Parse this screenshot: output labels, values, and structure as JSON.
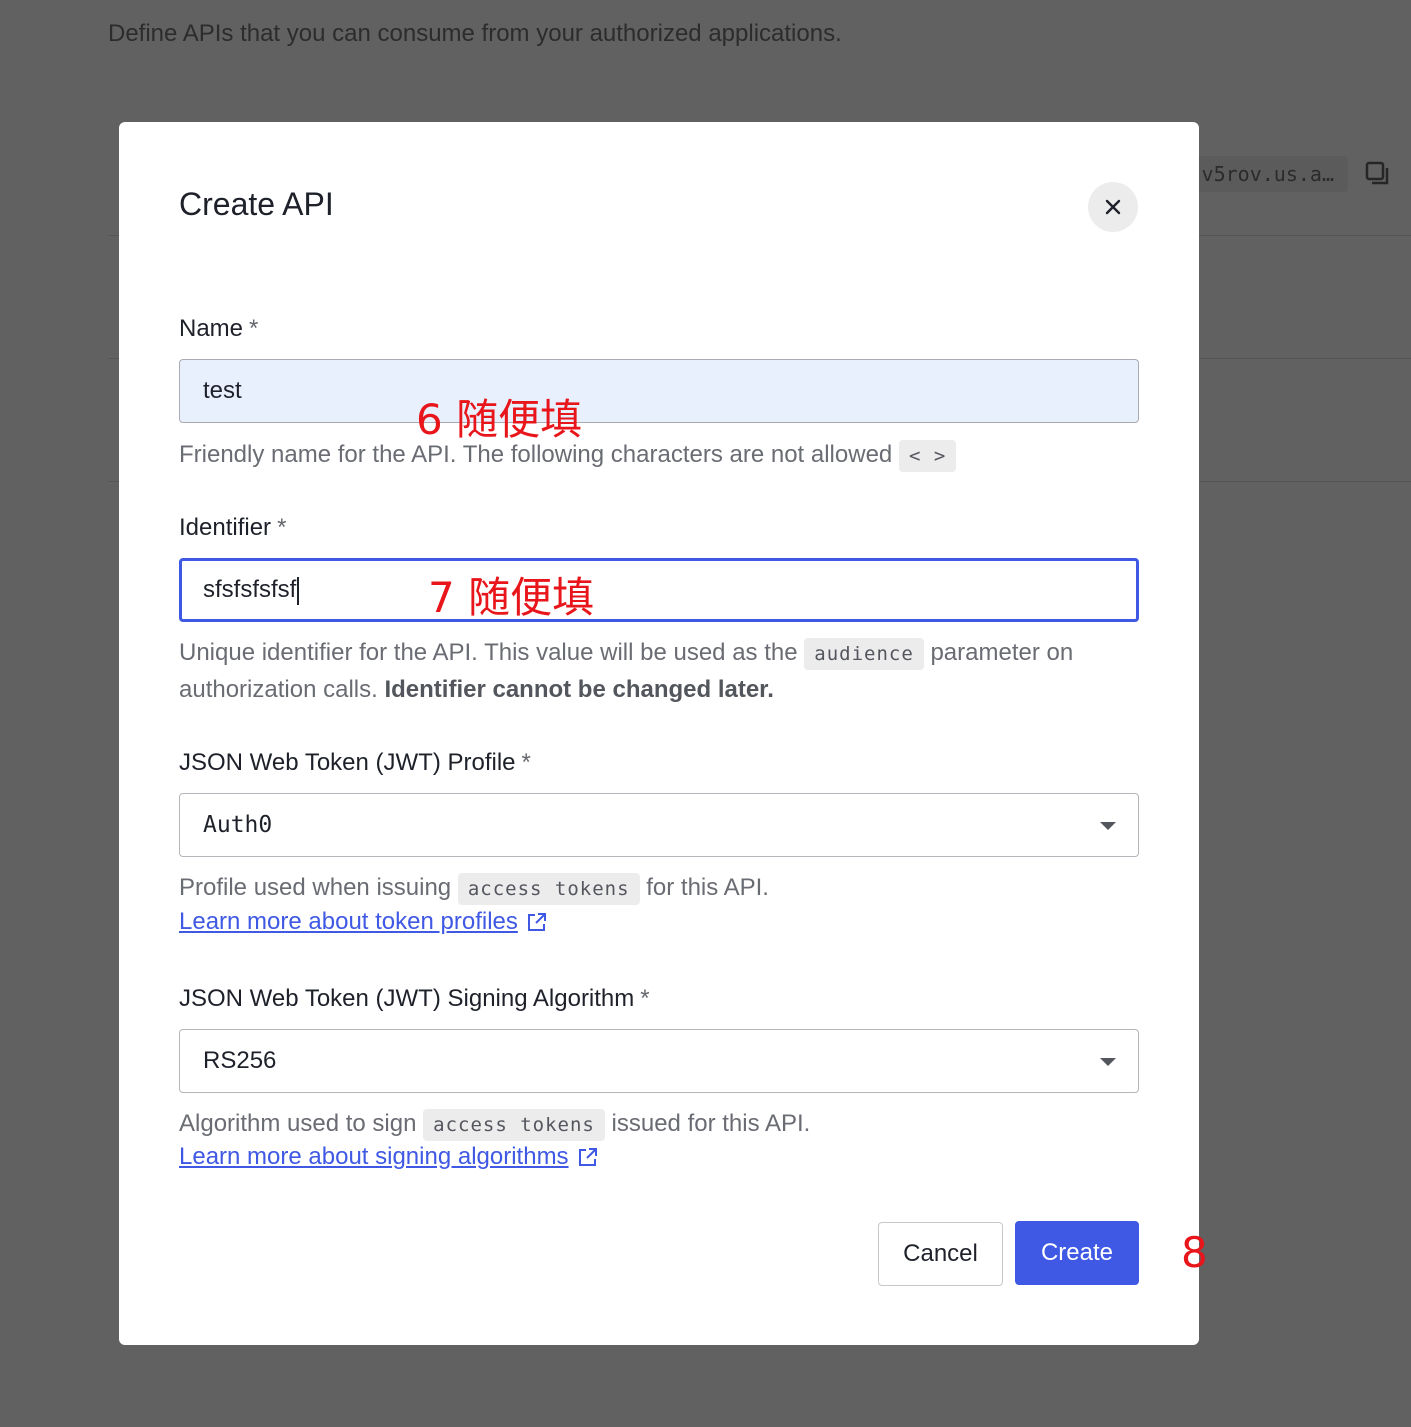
{
  "background": {
    "description": "Define APIs that you can consume from your authorized applications.",
    "domain_value": "v5rov.us.a…",
    "copy_icon": "copy-icon"
  },
  "modal": {
    "title": "Create API",
    "close_icon": "close-icon"
  },
  "form": {
    "name": {
      "label": "Name",
      "required": "*",
      "value": "test",
      "help": "Friendly name for the API. The following characters are not allowed",
      "disallowed_chars": "< >"
    },
    "identifier": {
      "label": "Identifier",
      "required": "*",
      "value": "sfsfsfsfsf",
      "help_before": "Unique identifier for the API. This value will be used as the",
      "help_code": "audience",
      "help_after": "parameter on authorization calls.",
      "help_bold": "Identifier cannot be changed later."
    },
    "jwt_profile": {
      "label": "JSON Web Token (JWT) Profile",
      "required": "*",
      "value": "Auth0",
      "help_before": "Profile used when issuing",
      "help_code": "access tokens",
      "help_after": "for this API.",
      "link": "Learn more about token profiles"
    },
    "signing_algorithm": {
      "label": "JSON Web Token (JWT) Signing Algorithm",
      "required": "*",
      "value": "RS256",
      "help_before": "Algorithm used to sign",
      "help_code": "access tokens",
      "help_after": "issued for this API.",
      "link": "Learn more about signing algorithms"
    }
  },
  "buttons": {
    "cancel": "Cancel",
    "create": "Create"
  },
  "annotations": {
    "step6": "6 随便填",
    "step7": "7 随便填",
    "step8": "8",
    "color": "#e8161b"
  },
  "colors": {
    "primary": "#3f59e4",
    "overlay": "#616161",
    "filled_input": "#e8effd"
  }
}
